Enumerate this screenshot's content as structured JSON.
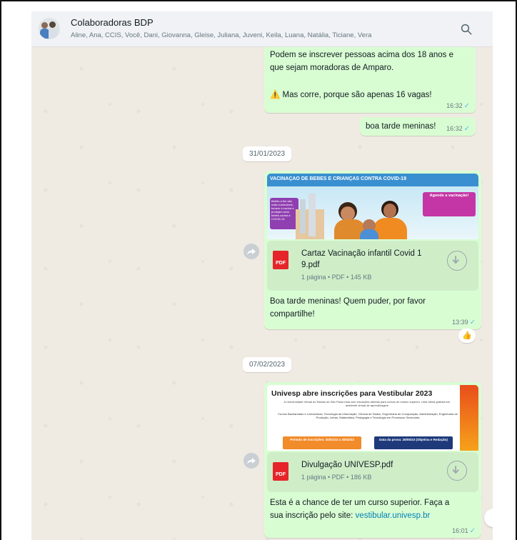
{
  "header": {
    "group_name": "Colaboradoras BDP",
    "members": "Aline, Ana, CCIS, Você, Dani, Giovanna, Gleise, Juliana, Juveni, Keila, Luana, Natália, Ticiane, Vera"
  },
  "messages": {
    "m1": {
      "text_line1": "Podem se inscrever pessoas acima dos 18 anos e",
      "text_line2": "que sejam moradoras de Amparo.",
      "warning_icon": "⚠️",
      "warning_text": "Mas corre, porque são apenas 16 vagas!",
      "time": "16:32"
    },
    "m2": {
      "text": "boa tarde meninas!",
      "time": "16:32"
    },
    "date1": "31/01/2023",
    "m3": {
      "poster_title": "VACINAÇÃO DE BEBÊS E CRIANÇAS CONTRA COVID-19",
      "poster_callout": "Agende a vacinação!",
      "poster_left": "Bebês a 6m são mais vulneráveis, tomem a vacina e protejam seus bebês contra a COVID-19",
      "file_name_line1": "Cartaz Vacinação infantil Covid 1",
      "file_name_line2": "9.pdf",
      "file_meta": "1 página • PDF • 145 KB",
      "caption_line1": "Boa tarde meninas! Quem puder, por favor",
      "caption_line2": "compartilhe!",
      "time": "13:39",
      "reaction": "👍"
    },
    "date2": "07/02/2023",
    "m4": {
      "poster_title": "Univesp abre inscrições para Vestibular 2023",
      "poster_sub": "A Universidade Virtual do Estado de São Paulo está com inscrições abertas para cursos de ensino superior. Uma ótima gratuita em ambiente virtual de aprendizagem",
      "poster_courses": "Cursos Bacharelado e Licenciatura: Tecnologia da Informação, Ciência de Dados, Engenharia de Computação, Administração, Engenharia de Produção, Letras, Matemática, Pedagogia e Tecnologia em Processos Gerenciais",
      "poster_period": "Período de inscrições: 30/01/23 a 30/03/23",
      "poster_exam": "Data da prova: 28/05/23 (Objetiva e Redação)",
      "file_name": "Divulgação UNIVESP.pdf",
      "file_meta": "1 página • PDF • 186 KB",
      "caption_line1": "Esta é a chance de ter um curso superior. Faça a",
      "caption_prefix": "sua inscrição pelo site: ",
      "caption_link": "vestibular.univesp.br",
      "time": "16:01"
    }
  },
  "icons": {
    "pdf_label": "PDF",
    "tick": "✓"
  },
  "colors": {
    "outgoing_bubble": "#d9fdd3",
    "chat_background": "#efeae2",
    "header_background": "#f0f2f5",
    "link": "#027eb5",
    "tick": "#53bdeb"
  }
}
